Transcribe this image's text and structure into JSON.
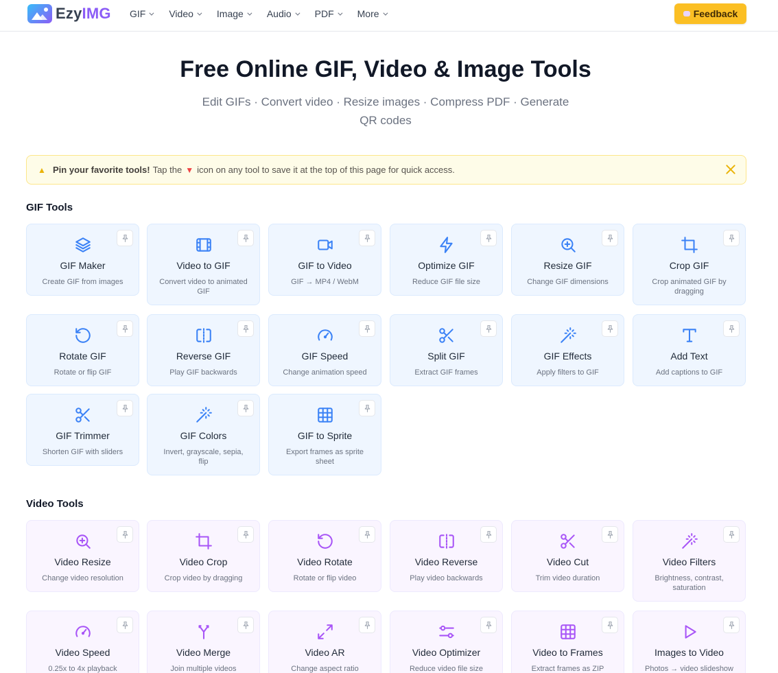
{
  "header": {
    "logo_part1": "Ezy",
    "logo_part2": "IMG",
    "nav": [
      "GIF",
      "Video",
      "Image",
      "Audio",
      "PDF",
      "More"
    ],
    "feedback_label": "Feedback"
  },
  "hero": {
    "title": "Free Online GIF, Video & Image Tools",
    "subtitle": "Edit GIFs · Convert video · Resize images · Compress PDF · Generate QR codes"
  },
  "banner": {
    "strong": "Pin your favorite tools!",
    "text_before": "Tap the",
    "text_after": "icon on any tool to save it at the top of this page for quick access."
  },
  "sections": {
    "gif_title": "GIF Tools",
    "video_title": "Video Tools"
  },
  "gif_tools": [
    {
      "title": "GIF Maker",
      "desc": "Create GIF from images",
      "icon": "layers-icon"
    },
    {
      "title": "Video to GIF",
      "desc": "Convert video to animated GIF",
      "icon": "film-icon"
    },
    {
      "title": "GIF to Video",
      "desc": "GIF → MP4 / WebM",
      "icon": "video-camera-icon"
    },
    {
      "title": "Optimize GIF",
      "desc": "Reduce GIF file size",
      "icon": "lightning-icon"
    },
    {
      "title": "Resize GIF",
      "desc": "Change GIF dimensions",
      "icon": "zoom-in-icon"
    },
    {
      "title": "Crop GIF",
      "desc": "Crop animated GIF by dragging",
      "icon": "crop-icon"
    },
    {
      "title": "Rotate GIF",
      "desc": "Rotate or flip GIF",
      "icon": "rotate-icon"
    },
    {
      "title": "Reverse GIF",
      "desc": "Play GIF backwards",
      "icon": "flip-icon"
    },
    {
      "title": "GIF Speed",
      "desc": "Change animation speed",
      "icon": "speedometer-icon"
    },
    {
      "title": "Split GIF",
      "desc": "Extract GIF frames",
      "icon": "scissors-icon"
    },
    {
      "title": "GIF Effects",
      "desc": "Apply filters to GIF",
      "icon": "magic-wand-icon"
    },
    {
      "title": "Add Text",
      "desc": "Add captions to GIF",
      "icon": "text-icon"
    },
    {
      "title": "GIF Trimmer",
      "desc": "Shorten GIF with sliders",
      "icon": "scissors-icon"
    },
    {
      "title": "GIF Colors",
      "desc": "Invert, grayscale, sepia, flip",
      "icon": "magic-wand-icon"
    },
    {
      "title": "GIF to Sprite",
      "desc": "Export frames as sprite sheet",
      "icon": "grid-icon"
    }
  ],
  "video_tools": [
    {
      "title": "Video Resize",
      "desc": "Change video resolution",
      "icon": "zoom-in-icon"
    },
    {
      "title": "Video Crop",
      "desc": "Crop video by dragging",
      "icon": "crop-icon"
    },
    {
      "title": "Video Rotate",
      "desc": "Rotate or flip video",
      "icon": "rotate-icon"
    },
    {
      "title": "Video Reverse",
      "desc": "Play video backwards",
      "icon": "flip-icon"
    },
    {
      "title": "Video Cut",
      "desc": "Trim video duration",
      "icon": "scissors-icon"
    },
    {
      "title": "Video Filters",
      "desc": "Brightness, contrast, saturation",
      "icon": "magic-wand-icon"
    },
    {
      "title": "Video Speed",
      "desc": "0.25x to 4x playback",
      "icon": "speedometer-icon"
    },
    {
      "title": "Video Merge",
      "desc": "Join multiple videos",
      "icon": "merge-icon"
    },
    {
      "title": "Video AR",
      "desc": "Change aspect ratio",
      "icon": "expand-icon"
    },
    {
      "title": "Video Optimizer",
      "desc": "Reduce video file size",
      "icon": "sliders-icon"
    },
    {
      "title": "Video to Frames",
      "desc": "Extract frames as ZIP",
      "icon": "grid-icon"
    },
    {
      "title": "Images to Video",
      "desc": "Photos → video slideshow",
      "icon": "play-icon"
    }
  ],
  "colors": {
    "accent_gif": "#3b82f6",
    "accent_video": "#a855f7",
    "feedback_bg": "#fbbf24"
  }
}
